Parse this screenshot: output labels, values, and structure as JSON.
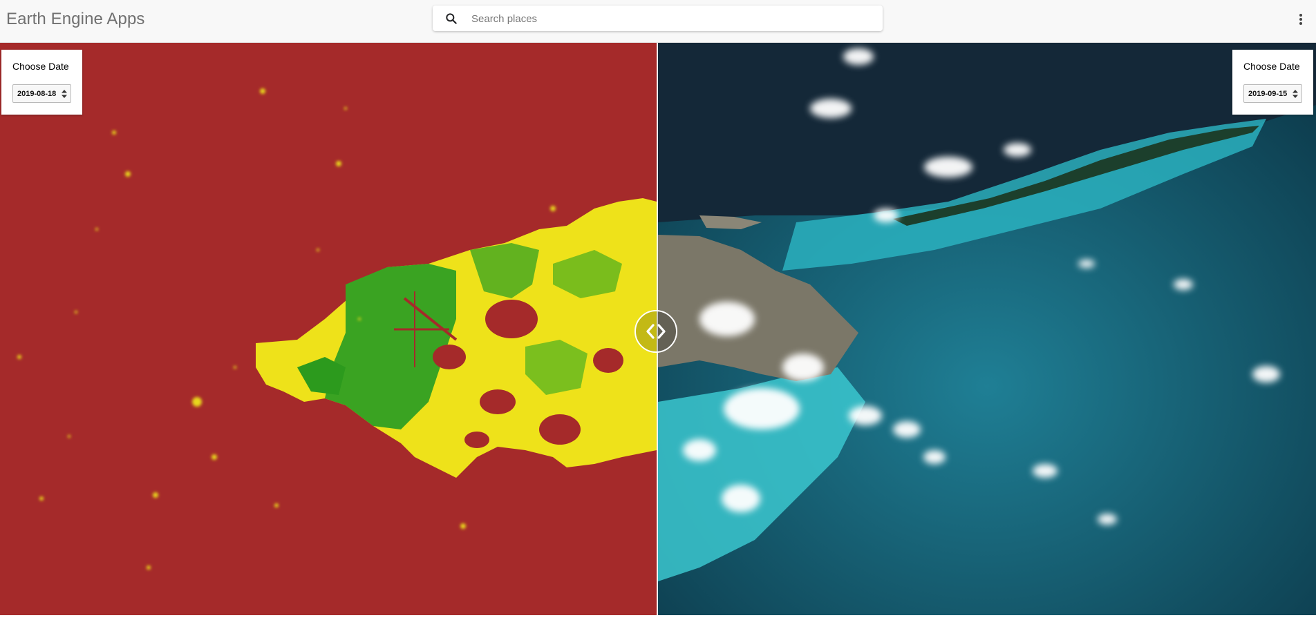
{
  "header": {
    "app_title": "Earth Engine Apps",
    "search_placeholder": "Search places"
  },
  "left_panel": {
    "label": "Choose Date",
    "date_value": "2019-08-18"
  },
  "right_panel": {
    "label": "Choose Date",
    "date_value": "2019-09-15"
  },
  "icons": {
    "search": "search-icon",
    "menu": "more-vert-icon",
    "swipe": "chevron-left-right-icon",
    "stepper": "up-down-arrows-icon"
  },
  "colors": {
    "left_map_background": "#a52a2a",
    "vegetation_green": "#2fa31f",
    "vegetation_yellow": "#f0e81a",
    "right_map_water": "#0f4a5c",
    "shallow_water": "#34c6cf"
  }
}
